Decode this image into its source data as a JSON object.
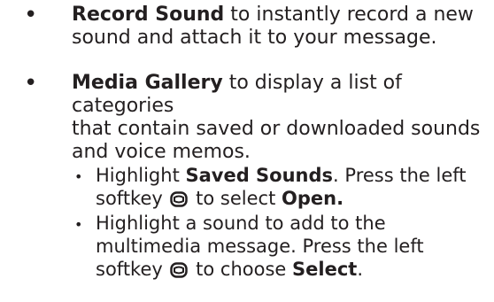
{
  "items": [
    {
      "bullet": "•",
      "title": "Record Sound",
      "rest_line1": " to instantly record a new",
      "line2": "sound and attach it to your message."
    },
    {
      "bullet": "•",
      "title": "Media Gallery",
      "rest_line1": " to display a list of categories",
      "line2": "that contain saved or downloaded sounds",
      "line3": "and voice memos."
    }
  ],
  "subitems": [
    {
      "bullet": "•",
      "pre1": "Highlight ",
      "bold1": "Saved Sounds",
      "post1": ". Press the left",
      "pre2": "softkey ",
      "icon": "left-softkey-icon",
      "mid2": " to select ",
      "bold2": "Open."
    },
    {
      "bullet": "•",
      "line1": "Highlight a sound to add to the",
      "line2": "multimedia message. Press the left",
      "pre3": "softkey ",
      "icon": "left-softkey-icon",
      "mid3": " to choose ",
      "bold3": "Select",
      "post3": "."
    }
  ]
}
